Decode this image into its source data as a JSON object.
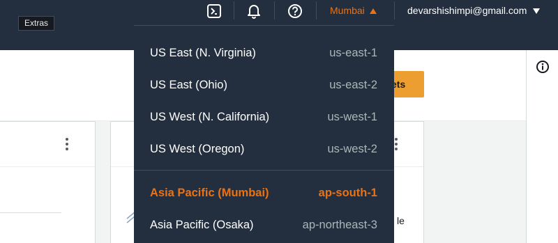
{
  "nav": {
    "tooltip": "Extras",
    "region_label": "Mumbai",
    "account_label": "devarshishimpi@gmail.com",
    "icons": [
      "cloudshell-icon",
      "notifications-icon",
      "help-icon"
    ]
  },
  "colors": {
    "nav_bg": "#232f3e",
    "accent": "#ec7211",
    "primary_button": "#ec9e31"
  },
  "page": {
    "button_partial_label": "ets",
    "partial_text": "le"
  },
  "region_menu": {
    "group1": [
      {
        "name": "US East (N. Virginia)",
        "code": "us-east-1"
      },
      {
        "name": "US East (Ohio)",
        "code": "us-east-2"
      },
      {
        "name": "US West (N. California)",
        "code": "us-west-1"
      },
      {
        "name": "US West (Oregon)",
        "code": "us-west-2"
      }
    ],
    "group2": [
      {
        "name": "Asia Pacific (Mumbai)",
        "code": "ap-south-1",
        "selected": true
      },
      {
        "name": "Asia Pacific (Osaka)",
        "code": "ap-northeast-3"
      }
    ]
  }
}
